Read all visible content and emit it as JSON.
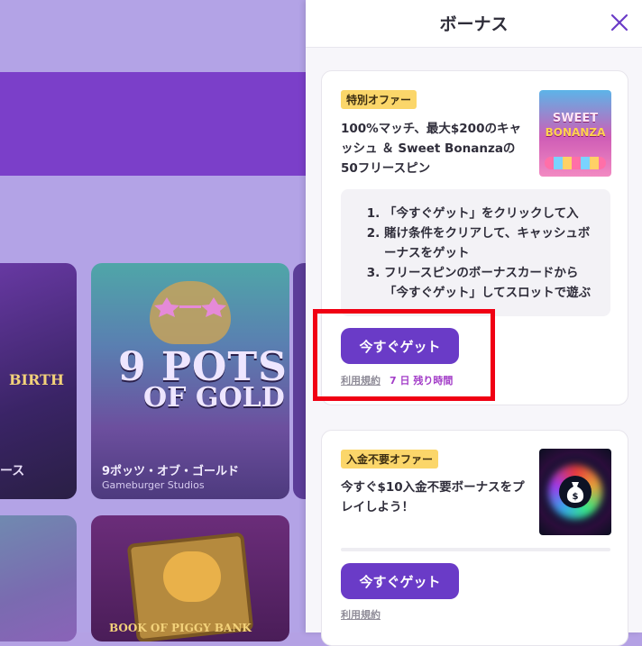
{
  "background": {
    "tiles": [
      {
        "name": "tile-left-1",
        "title_fragment": "BIRTH",
        "caption_fragment": "ース"
      },
      {
        "name": "tile-pots",
        "logo_line1": "9 POTS",
        "logo_line2": "OF GOLD",
        "title": "9ポッツ・オブ・ゴールド",
        "provider": "Gameburger Studios"
      },
      {
        "name": "tile-pig",
        "logo_text": "BOOK OF PIGGY BANK"
      }
    ]
  },
  "drawer": {
    "title": "ボーナス",
    "close_icon": "close-icon",
    "cards": [
      {
        "badge": "特別オファー",
        "offer_text": "100%マッチ、最大$200のキャッシュ ＆ Sweet Bonanzaの50フリースピン",
        "thumb": {
          "line1": "SWEET",
          "line2": "BONANZA"
        },
        "steps": [
          "「今すぐゲット」をクリックして入",
          "賭け条件をクリアして、キャッシュボーナスをゲット",
          "フリースピンのボーナスカードから「今すぐゲット」してスロットで遊ぶ"
        ],
        "cta": "今すぐゲット",
        "terms": "利用規約",
        "remaining": "7 日 残り時間"
      },
      {
        "badge": "入金不要オファー",
        "offer_text": "今すぐ$10入金不要ボーナスをプレイしよう！",
        "cta": "今すぐゲット",
        "terms": "利用規約"
      }
    ]
  },
  "colors": {
    "accent": "#6a3bc7",
    "badge_bg": "#fbd66a",
    "remaining_text": "#a33dc8",
    "highlight": "#f00013"
  }
}
